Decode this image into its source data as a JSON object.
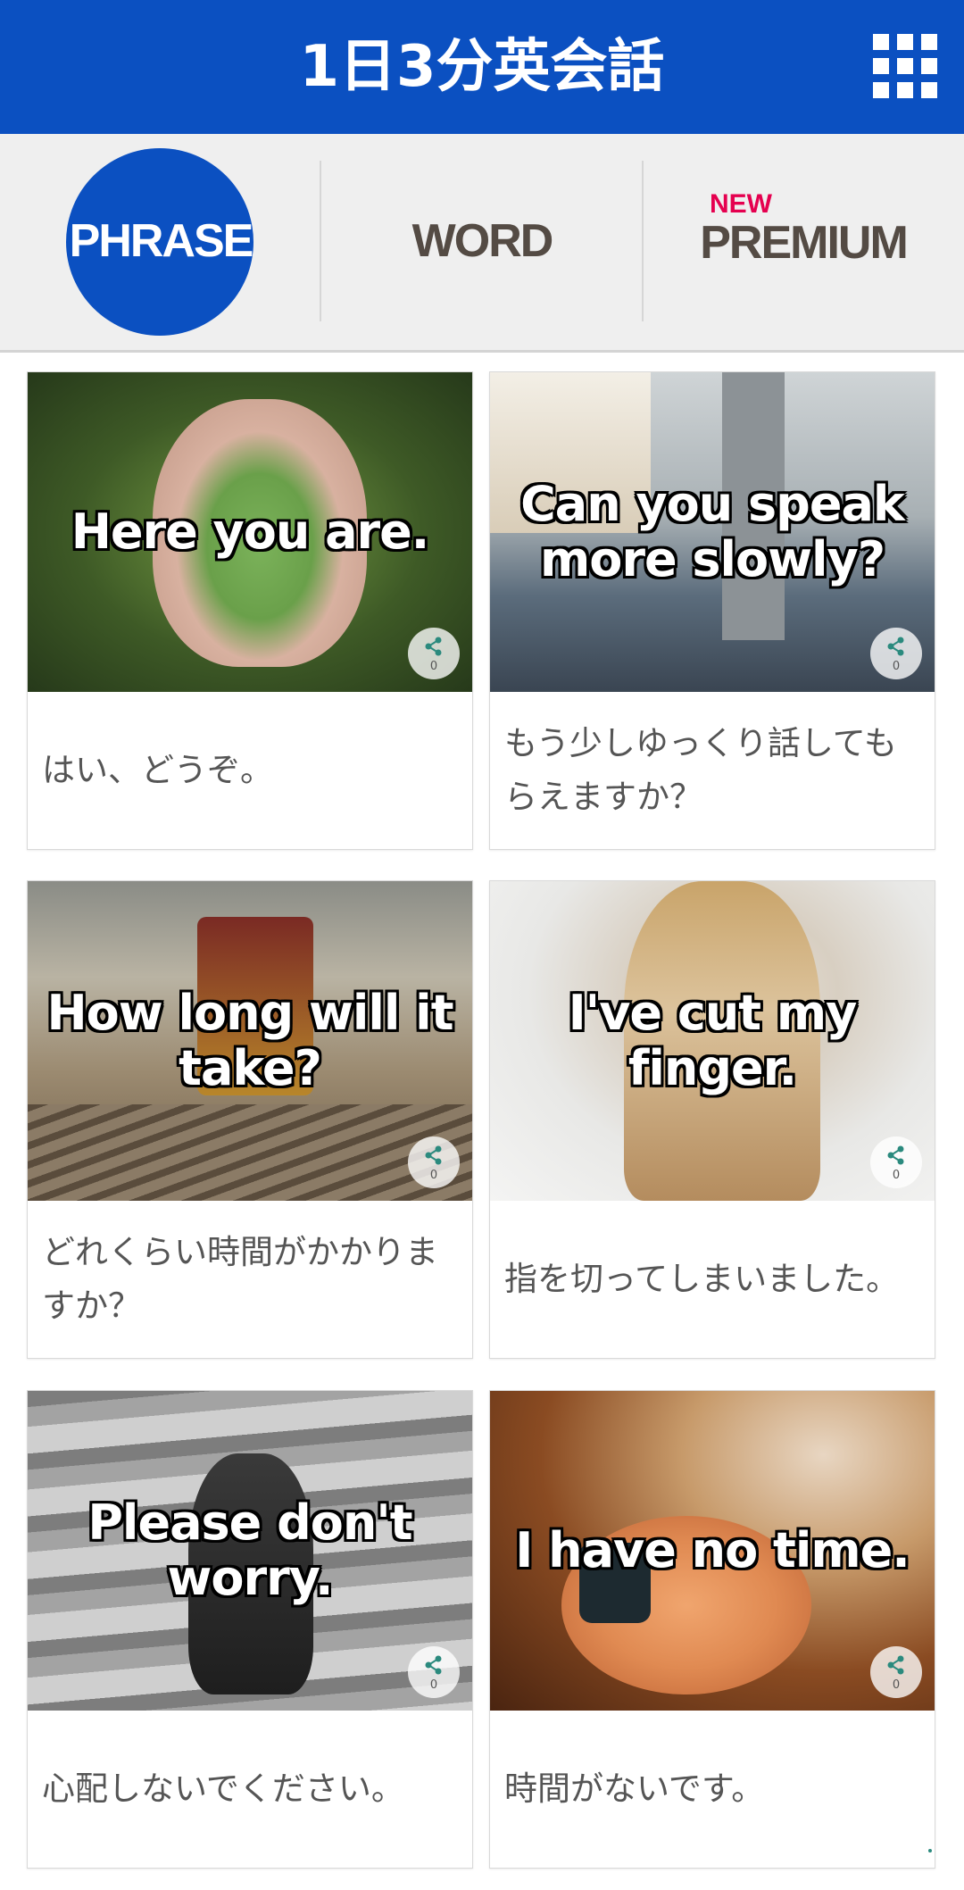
{
  "header": {
    "title": "1日3分英会話",
    "menu_icon": "grid-icon",
    "color": "#0b50c1"
  },
  "tabs": {
    "phrase": "PHRASE",
    "word": "WORD",
    "premium_badge": "NEW",
    "premium": "PREMIUM",
    "active": "phrase"
  },
  "cards": [
    {
      "caption": "Here you are.",
      "translation": "はい、どうぞ。",
      "share_count": "0"
    },
    {
      "caption": "Can you speak more slowly?",
      "translation": "もう少しゆっくり話してもらえますか？",
      "share_count": "0"
    },
    {
      "caption": "How long will it take?",
      "translation": "どれくらい時間がかかりますか？",
      "share_count": "0"
    },
    {
      "caption": "I've cut my finger.",
      "translation": "指を切ってしまいました。",
      "share_count": "0"
    },
    {
      "caption": "Please don't worry.",
      "translation": "心配しないでください。",
      "share_count": "0"
    },
    {
      "caption": "I have no time.",
      "translation": "時間がないです。",
      "share_count": "0"
    }
  ]
}
